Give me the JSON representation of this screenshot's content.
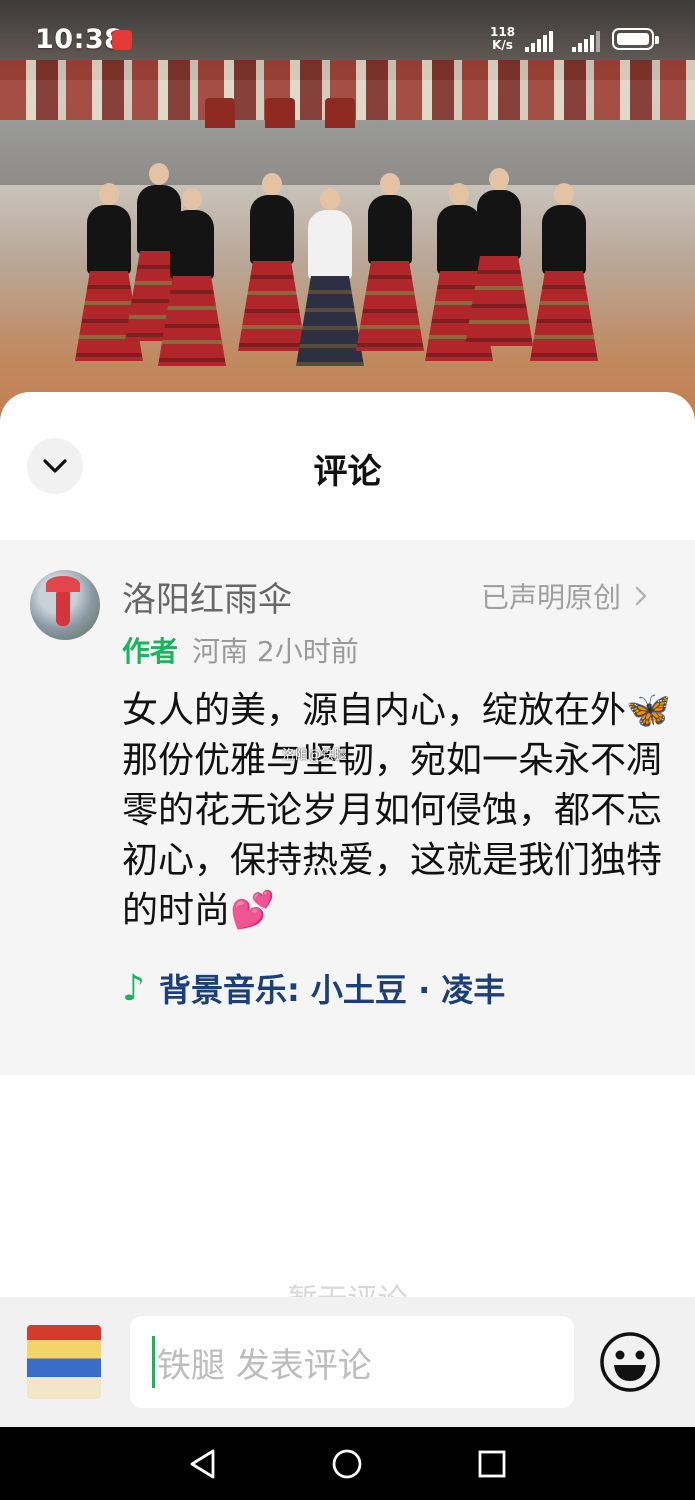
{
  "status_bar": {
    "time": "10:38",
    "net_speed_value": "118",
    "net_speed_unit": "K/s"
  },
  "sheet": {
    "title": "评论",
    "collapse_icon": "chevron-down-icon"
  },
  "comment": {
    "author_name": "洛阳红雨伞",
    "original_label": "已声明原创",
    "author_tag": "作者",
    "location": "河南",
    "time_ago": "2小时前",
    "text": "女人的美，源自内心，绽放在外🦋那份优雅与坚韧，宛如一朵永不凋零的花无论岁月如何侵蚀，都不忘初心，保持热爱，这就是我们独特的时尚💕",
    "music_label": "背景音乐: 小土豆 · 凌丰",
    "watermark": "洛阳@铁腿"
  },
  "empty_hint": "暂无评论",
  "input_bar": {
    "placeholder": "铁腿 发表评论",
    "emoji_icon": "smile-icon"
  },
  "nav": {
    "back": "back-triangle-icon",
    "home": "home-circle-icon",
    "recents": "recents-square-icon"
  },
  "colors": {
    "accent_green": "#19b55a",
    "music_blue": "#1c3f7a"
  }
}
